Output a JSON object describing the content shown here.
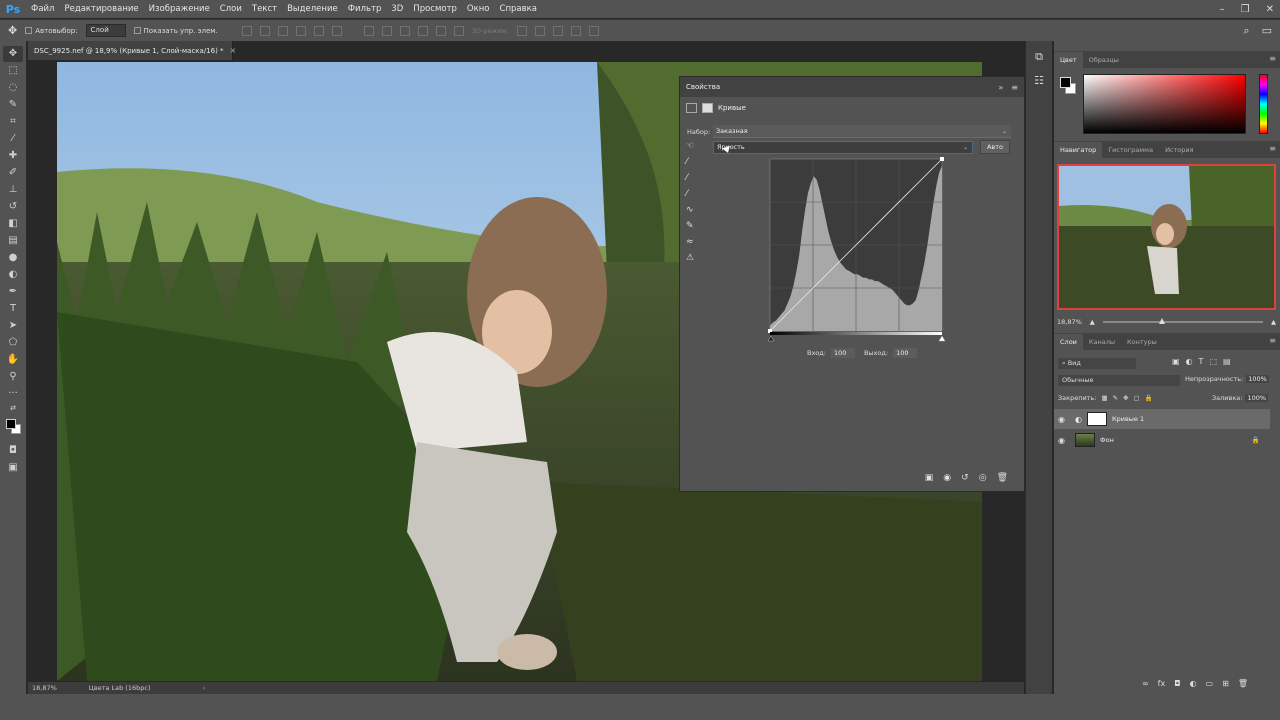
{
  "app": {
    "logo": "Ps"
  },
  "menu": [
    "Файл",
    "Редактирование",
    "Изображение",
    "Слои",
    "Текст",
    "Выделение",
    "Фильтр",
    "3D",
    "Просмотр",
    "Окно",
    "Справка"
  ],
  "options_bar": {
    "autoselect_label": "Автовыбор:",
    "autoselect_value": "Слой",
    "show_transform_label": "Показать упр. элем.",
    "mode_3d": "3D-режим:"
  },
  "document": {
    "tab_title": "DSC_9925.nef @ 18,9% (Кривые 1, Слой-маска/16) *",
    "close": "×"
  },
  "status": {
    "zoom": "18,87%",
    "info": "Цвета Lab (16bpc)",
    "arrow": "›"
  },
  "properties": {
    "title": "Свойства",
    "adjustment": "Кривые",
    "preset_label": "Набор:",
    "preset_value": "Заказная",
    "channel_value": "Яркость",
    "auto_label": "Авто",
    "input_label": "Вход:",
    "input_value": "100",
    "output_label": "Выход:",
    "output_value": "100",
    "histogram": [
      3,
      5,
      6,
      8,
      10,
      12,
      16,
      20,
      26,
      34,
      44,
      58,
      70,
      80,
      86,
      90,
      88,
      82,
      74,
      66,
      58,
      52,
      47,
      43,
      40,
      38,
      36,
      35,
      34,
      33,
      33,
      32,
      31,
      31,
      30,
      30,
      29,
      29,
      28,
      27,
      26,
      25,
      24,
      22,
      20,
      18,
      16,
      15,
      15,
      16,
      18,
      24,
      32,
      40,
      50,
      62,
      74,
      84,
      92,
      96
    ],
    "curve_points": [
      [
        0,
        0
      ],
      [
        255,
        255
      ]
    ]
  },
  "color_panel": {
    "tabs": [
      "Цвет",
      "Образцы"
    ]
  },
  "navigator": {
    "tabs": [
      "Навигатор",
      "Гистограмма",
      "История"
    ],
    "zoom": "18,87%",
    "zoom_level": 0.35
  },
  "layers": {
    "tabs": [
      "Слои",
      "Каналы",
      "Контуры"
    ],
    "filter": "Вид",
    "blend_mode": "Обычные",
    "opacity_label": "Непрозрачность:",
    "opacity_value": "100%",
    "lock_label": "Закрепить:",
    "fill_label": "Заливка:",
    "fill_value": "100%",
    "items": [
      {
        "name": "Кривые 1",
        "selected": true
      },
      {
        "name": "Фон",
        "selected": false
      }
    ]
  }
}
